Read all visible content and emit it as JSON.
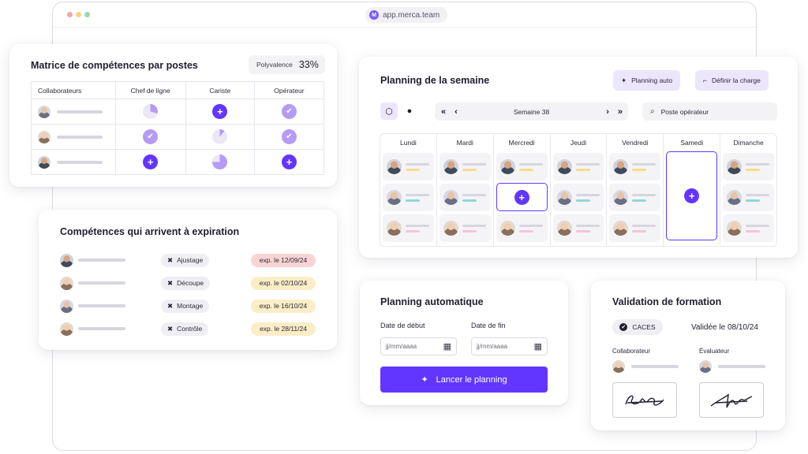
{
  "browser": {
    "url": "app.merca.team",
    "logo_letter": "M",
    "dot_colors": [
      "#f6a6a6",
      "#f6d28a",
      "#9ad9b0"
    ]
  },
  "matrix": {
    "title": "Matrice de compétences par postes",
    "polyvalence_label": "Polyvalence",
    "polyvalence_value": "33%",
    "headers": [
      "Collaborateurs",
      "Chef de ligne",
      "Cariste",
      "Opérateur"
    ],
    "rows": [
      {
        "cells": [
          "pie-quarter",
          "plus",
          "check"
        ]
      },
      {
        "cells": [
          "check",
          "pie-tenth",
          "check"
        ]
      },
      {
        "cells": [
          "plus",
          "pie-threequarter",
          "plus"
        ]
      }
    ]
  },
  "expiration": {
    "title": "Compétences qui arrivent à expiration",
    "rows": [
      {
        "skill": "Ajustage",
        "expiry": "exp. le 12/09/24",
        "status_color": "#f9d4d4"
      },
      {
        "skill": "Découpe",
        "expiry": "exp. le 02/10/24",
        "status_color": "#fbedc6"
      },
      {
        "skill": "Montage",
        "expiry": "exp. le 16/10/24",
        "status_color": "#fbedc6"
      },
      {
        "skill": "Contrôle",
        "expiry": "exp. le 28/11/24",
        "status_color": "#fbedc6"
      }
    ]
  },
  "week": {
    "title": "Planning de la semaine",
    "auto_label": "Planning auto",
    "charge_label": "Définir la charge",
    "week_label": "Semaine 38",
    "search_placeholder": "Poste opérateur",
    "days": [
      "Lundi",
      "Mardi",
      "Mercredi",
      "Jeudi",
      "Vendredi",
      "Samedi",
      "Dimanche"
    ]
  },
  "auto": {
    "title": "Planning automatique",
    "start_label": "Date de début",
    "end_label": "Date de fin",
    "date_placeholder": "jj/mm/aaaa",
    "launch_label": "Lancer le planning"
  },
  "validation": {
    "title": "Validation de formation",
    "badge": "CACES",
    "validated": "Validée le 08/10/24",
    "collab_label": "Collaborateur",
    "eval_label": "Évaluateur"
  },
  "colors": {
    "accent": "#6236ff",
    "accent_soft": "#b49cf5",
    "bar_yellow": "#f7dc8c",
    "bar_teal": "#8fd6d9",
    "bar_pink": "#f6c3d8"
  }
}
